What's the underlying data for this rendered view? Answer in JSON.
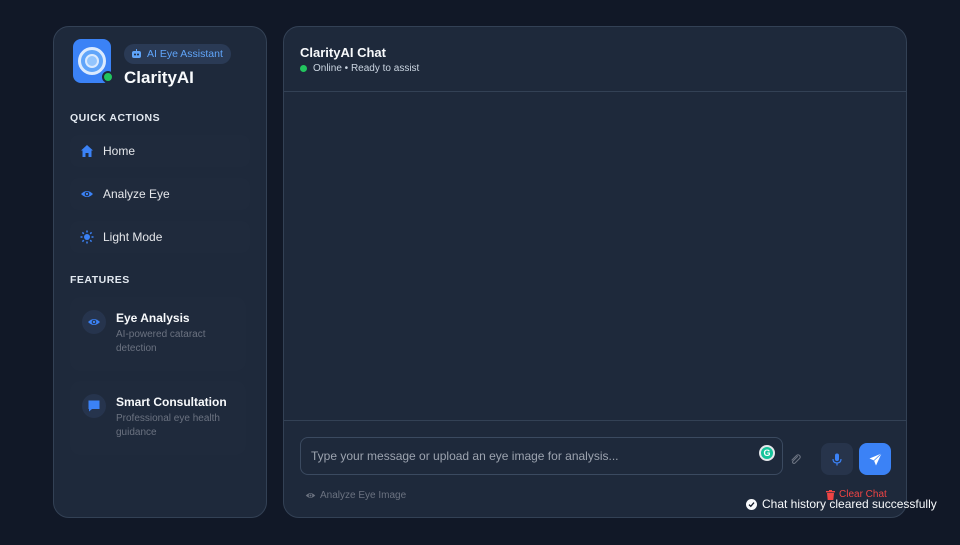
{
  "sidebar": {
    "badge": "AI Eye Assistant",
    "brand": "ClarityAI",
    "quick_actions_title": "QUICK ACTIONS",
    "quick_actions": [
      {
        "label": "Home",
        "icon": "home-icon"
      },
      {
        "label": "Analyze Eye",
        "icon": "eye-icon"
      },
      {
        "label": "Light Mode",
        "icon": "sun-icon"
      }
    ],
    "features_title": "FEATURES",
    "features": [
      {
        "title": "Eye Analysis",
        "desc": "AI-powered cataract detection",
        "icon": "eye-icon"
      },
      {
        "title": "Smart Consultation",
        "desc": "Professional eye health guidance",
        "icon": "chat-icon"
      }
    ]
  },
  "chat": {
    "title": "ClarityAI Chat",
    "status": "Online • Ready to assist",
    "input_placeholder": "Type your message or upload an eye image for analysis...",
    "input_value": "",
    "analyze_link": "Analyze Eye Image",
    "clear_link": "Clear Chat"
  },
  "toast": {
    "message": "Chat history cleared successfully"
  },
  "colors": {
    "accent": "#3b82f6",
    "online": "#22c55e",
    "danger": "#ef4444",
    "background": "#111827",
    "panel": "#1e293b"
  }
}
